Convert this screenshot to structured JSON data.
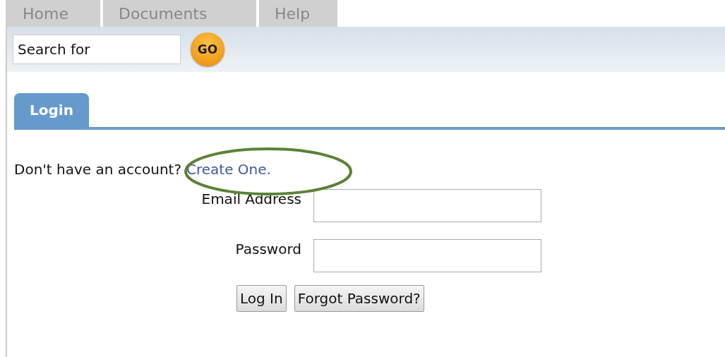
{
  "nav_tabs": [
    {
      "label": "Home",
      "selected": false
    },
    {
      "label": "Documents",
      "selected": false
    },
    {
      "label": "Help",
      "selected": false
    }
  ],
  "search": {
    "value": "Search for",
    "button": "GO"
  },
  "panel_tabs": [
    {
      "label": "Login",
      "selected": true
    }
  ],
  "signup_prompt": {
    "text": "Don't have an account?",
    "link": "Create One."
  },
  "fields": [
    {
      "label": "Email Address"
    },
    {
      "label": "Password"
    }
  ],
  "buttons": [
    "Log In",
    "Forgot Password?"
  ]
}
